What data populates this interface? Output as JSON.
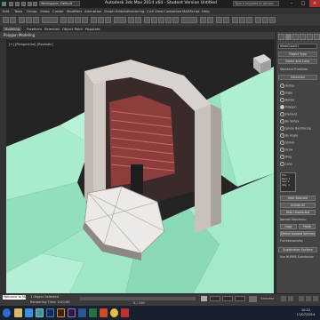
{
  "window": {
    "title": "Autodesk 3ds Max 2014 x64 - Student Version   Untitled",
    "workspace": "Workspace: Default",
    "search_placeholder": "Type a keyword or phrase"
  },
  "menu": [
    "Edit",
    "Tools",
    "Group",
    "Views",
    "Create",
    "Modifiers",
    "Animation",
    "Graph Editors",
    "Rendering",
    "Civil View",
    "Customize",
    "MAXScript",
    "Help"
  ],
  "ribbon": {
    "tabs": [
      "Modeling",
      "Freeform",
      "Selection",
      "Object Paint",
      "Populate"
    ],
    "active_tab": "Modeling",
    "subtitle": "Polygon Modeling"
  },
  "viewport": {
    "label": "[+] [Perspective] [Realistic]",
    "colors": {
      "ground": "#9fe8c8",
      "building_wall": "#c9c1bc",
      "interior": "#9a4040",
      "background": "#242424"
    }
  },
  "command_panel": {
    "object_name": "ViewCube01",
    "rollout_object_type": "Object Type",
    "rollout_name_color": "Name and Color",
    "section_header": "Standard Primitives",
    "rollout_selection": "Selection",
    "options": [
      {
        "label": "Vertex",
        "on": false
      },
      {
        "label": "Edge",
        "on": false
      },
      {
        "label": "Border",
        "on": false
      },
      {
        "label": "Polygon",
        "on": true
      },
      {
        "label": "Element",
        "on": false
      },
      {
        "label": "By Vertex",
        "on": false
      },
      {
        "label": "Ignore Backfacing",
        "on": false
      },
      {
        "label": "By Angle",
        "on": false
      },
      {
        "label": "Shrink",
        "on": false
      },
      {
        "label": "Grow",
        "on": false
      },
      {
        "label": "Ring",
        "on": false
      },
      {
        "label": "Loop",
        "on": false
      }
    ],
    "preview_box": "Pre-\nRed: 1\nSel: 1\nObj: 1",
    "buttons": [
      "Hide Selected",
      "Unhide All",
      "Hide Unselected",
      "Named Selections:",
      "Copy",
      "Paste",
      "Delete Isolated Vertices",
      "Full Interactivity",
      "Subdivision Surface",
      "Use NURMS Subdivision"
    ]
  },
  "status": {
    "welcome": "Welcome to MA",
    "objects_selected": "1 Object Selected",
    "rendering_time": "Rendering Time: 0:00:00",
    "frame_counter": "0 / 100",
    "set_key": "Selected"
  },
  "taskbar": {
    "apps": [
      "explorer",
      "ie",
      "3dsmax",
      "photoshop",
      "illustrator",
      "premiere",
      "word",
      "excel",
      "powerpoint",
      "chrome",
      "media"
    ],
    "clock_time": "10:22",
    "clock_date": "17/07/2014"
  }
}
